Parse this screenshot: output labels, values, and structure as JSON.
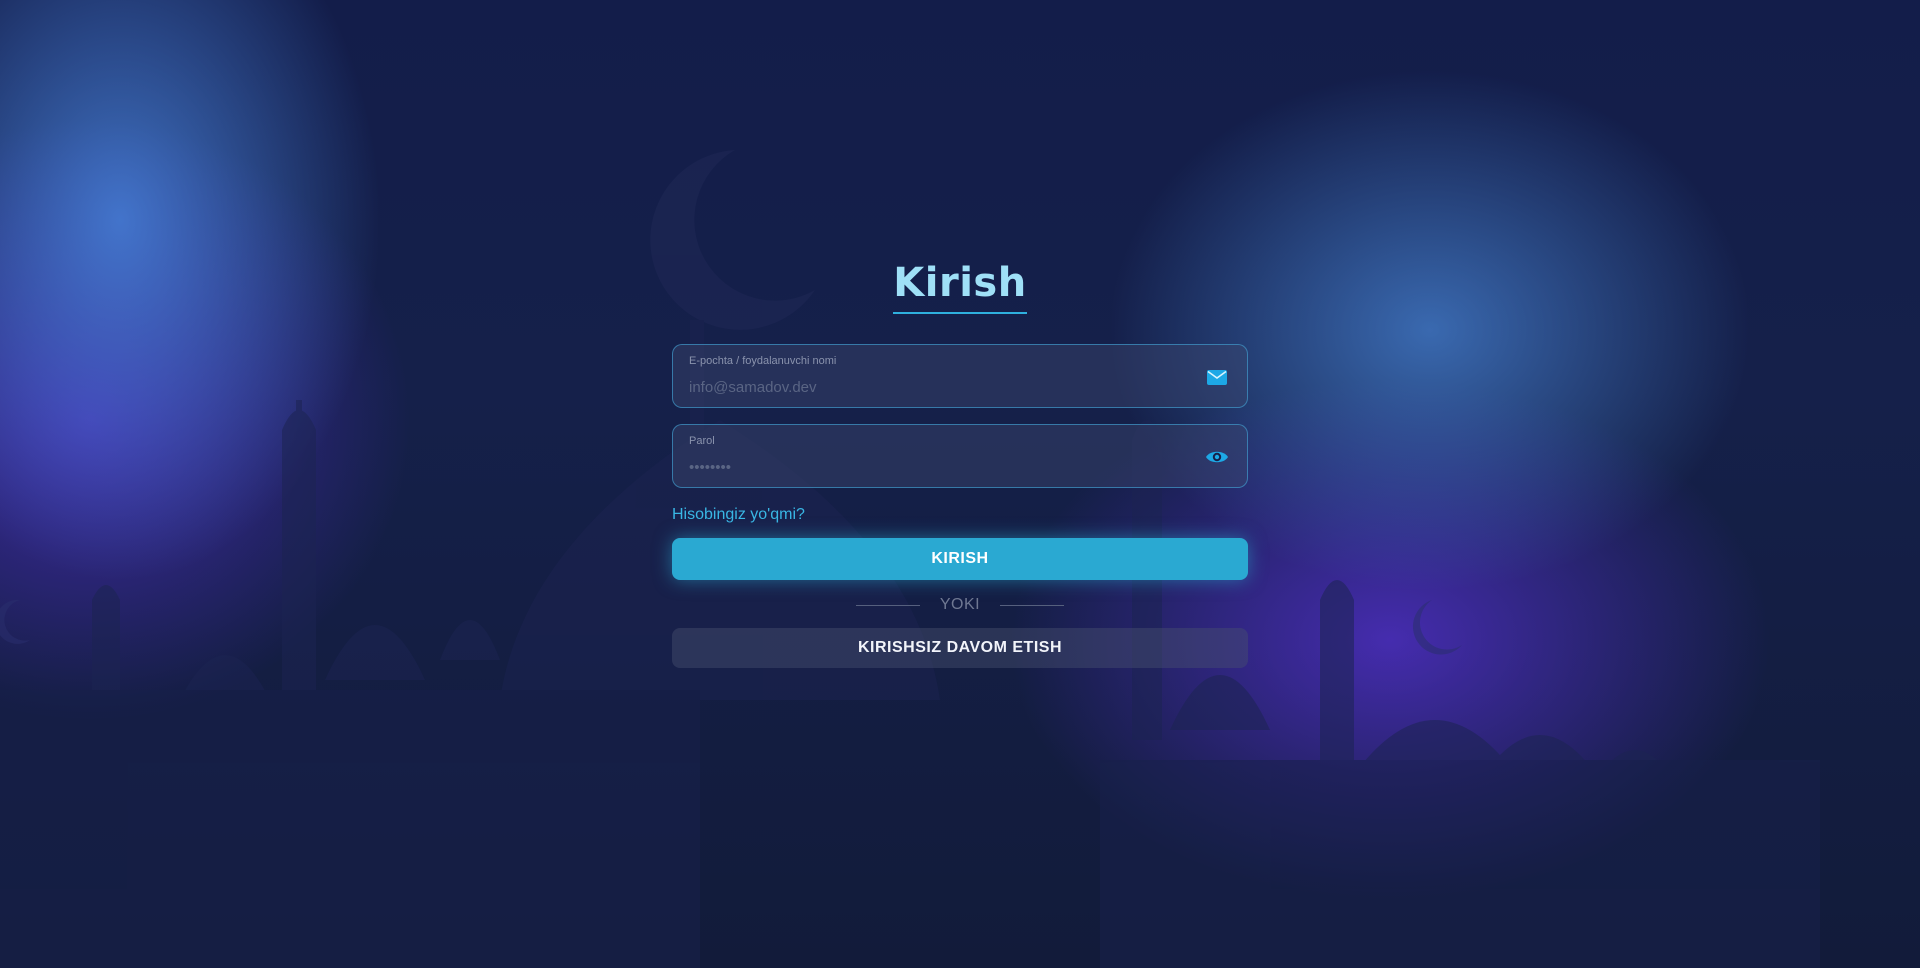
{
  "login": {
    "title": "Kirish",
    "email_field": {
      "label": "E-pochta / foydalanuvchi nomi",
      "placeholder": "info@samadov.dev",
      "value": "",
      "icon": "mail-icon"
    },
    "password_field": {
      "label": "Parol",
      "placeholder": "••••••••",
      "value": "",
      "icon": "eye-icon"
    },
    "signup_link": "Hisobingiz yo'qmi?",
    "submit_label": "KIRISH",
    "divider_text": "YOKI",
    "guest_label": "KIRISHSIZ DAVOM ETISH"
  },
  "colors": {
    "accent": "#2aa9d2",
    "title": "#9fe0f7",
    "link": "#39b6e4",
    "background": "#121b3a"
  }
}
